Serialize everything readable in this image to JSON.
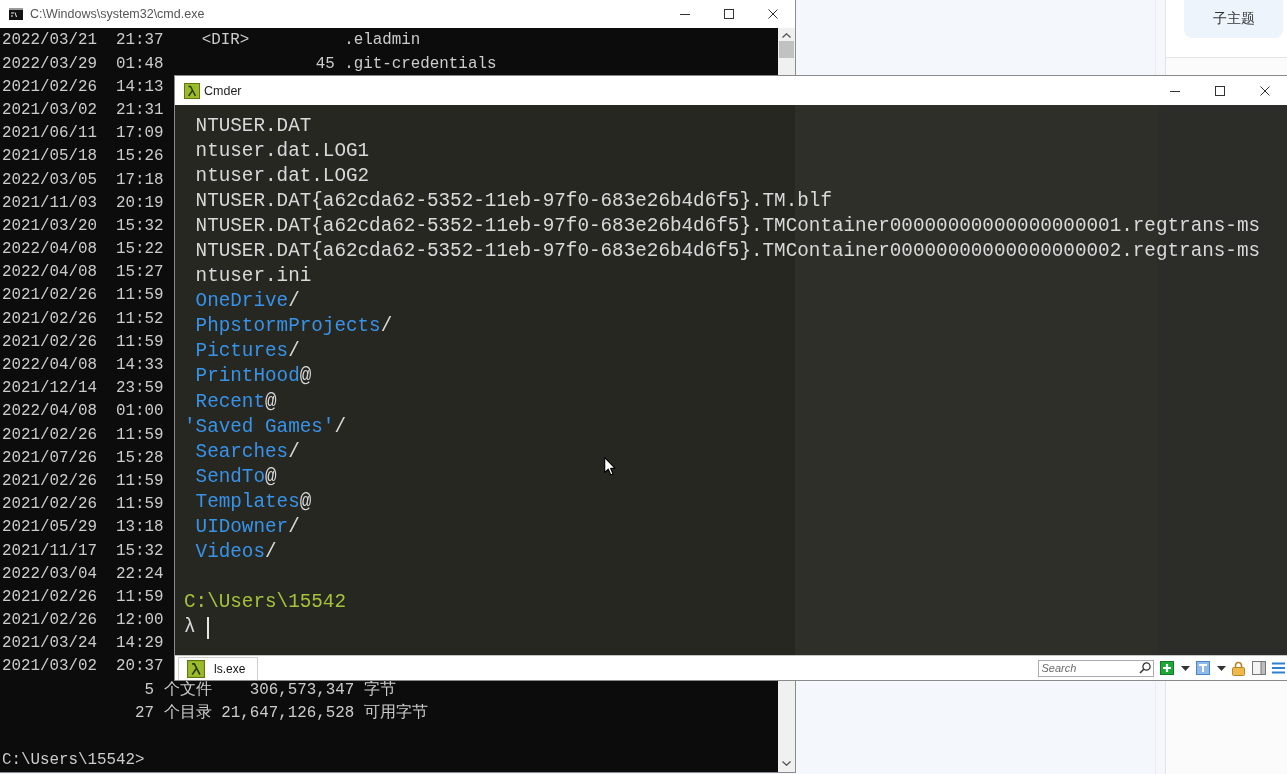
{
  "cmd_window": {
    "title": "C:\\Windows\\system32\\cmd.exe",
    "lines": [
      "2022/03/21  21:37    <DIR>          .eladmin",
      "2022/03/29  01:48                45 .git-credentials",
      "2021/02/26  14:13",
      "2021/03/02  21:31",
      "2021/06/11  17:09",
      "2021/05/18  15:26",
      "2022/03/05  17:18",
      "2021/11/03  20:19",
      "2021/03/20  15:32",
      "2022/04/08  15:22",
      "2022/04/08  15:27",
      "2021/02/26  11:59",
      "2021/02/26  11:52",
      "2021/02/26  11:59",
      "2022/04/08  14:33",
      "2021/12/14  23:59",
      "2022/04/08  01:00",
      "2021/02/26  11:59",
      "2021/07/26  15:28",
      "2021/02/26  11:59",
      "2021/02/26  11:59",
      "2021/05/29  13:18",
      "2021/11/17  15:32",
      "2022/03/04  22:24",
      "2021/02/26  11:59",
      "2021/02/26  12:00",
      "2021/03/24  14:29",
      "2021/03/02  20:37",
      "               5 个文件    306,573,347 字节",
      "              27 个目录 21,647,126,528 可用字节"
    ],
    "prompt": "C:\\Users\\15542>"
  },
  "cmder_window": {
    "title": "Cmder",
    "entries": [
      {
        "name": "NTUSER.DAT",
        "kind": "file"
      },
      {
        "name": "ntuser.dat.LOG1",
        "kind": "file"
      },
      {
        "name": "ntuser.dat.LOG2",
        "kind": "file"
      },
      {
        "name": "NTUSER.DAT{a62cda62-5352-11eb-97f0-683e26b4d6f5}.TM.blf",
        "kind": "file"
      },
      {
        "name": "NTUSER.DAT{a62cda62-5352-11eb-97f0-683e26b4d6f5}.TMContainer00000000000000000001.regtrans-ms",
        "kind": "file"
      },
      {
        "name": "NTUSER.DAT{a62cda62-5352-11eb-97f0-683e26b4d6f5}.TMContainer00000000000000000002.regtrans-ms",
        "kind": "file"
      },
      {
        "name": "ntuser.ini",
        "kind": "file"
      },
      {
        "name": "OneDrive",
        "suffix": "/",
        "kind": "dir"
      },
      {
        "name": "PhpstormProjects",
        "suffix": "/",
        "kind": "dir"
      },
      {
        "name": "Pictures",
        "suffix": "/",
        "kind": "dir"
      },
      {
        "name": "PrintHood",
        "suffix": "@",
        "kind": "link"
      },
      {
        "name": "Recent",
        "suffix": "@",
        "kind": "link"
      },
      {
        "name": "'Saved Games'",
        "suffix": "/",
        "kind": "quoted"
      },
      {
        "name": "Searches",
        "suffix": "/",
        "kind": "dir"
      },
      {
        "name": "SendTo",
        "suffix": "@",
        "kind": "link"
      },
      {
        "name": "Templates",
        "suffix": "@",
        "kind": "link"
      },
      {
        "name": "UIDowner",
        "suffix": "/",
        "kind": "dir"
      },
      {
        "name": "Videos",
        "suffix": "/",
        "kind": "dir"
      }
    ],
    "prompt": {
      "path": "C:\\Users\\15542",
      "symbol": "λ"
    },
    "tabs": [
      {
        "label": "ls.exe",
        "selected": true
      }
    ],
    "search": {
      "placeholder": "Search"
    }
  },
  "side_panel": {
    "button": "子主题"
  }
}
